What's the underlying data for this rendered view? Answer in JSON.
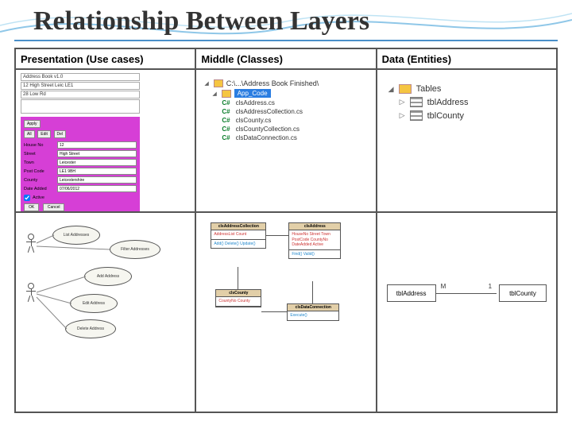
{
  "title": "Relationship Between Layers",
  "columns": {
    "c1": "Presentation (Use cases)",
    "c2": "Middle (Classes)",
    "c3": "Data (Entities)"
  },
  "form": {
    "list_header": "Address Book v1.0",
    "list_line2": "12 High Street Leic LE1",
    "list_line3": "28 Low Rd",
    "fields": {
      "houseNo": {
        "label": "House No",
        "value": "12"
      },
      "street": {
        "label": "Street",
        "value": "High Street"
      },
      "town": {
        "label": "Town",
        "value": "Leicester"
      },
      "postcode": {
        "label": "Post Code",
        "value": "LE1 9BH"
      },
      "county": {
        "label": "County",
        "value": "Leicestershire"
      },
      "dateAdded": {
        "label": "Date Added",
        "value": "07/06/2012"
      }
    },
    "buttons": {
      "apply": "Apply",
      "all": "All",
      "edit": "Edit",
      "delete": "Del"
    },
    "active": "Active",
    "ok": "OK",
    "cancel": "Cancel"
  },
  "solutionTree": {
    "root": "C:\\...\\Address Book Finished\\",
    "folder": "App_Code",
    "files": [
      "clsAddress.cs",
      "clsAddressCollection.cs",
      "clsCounty.cs",
      "clsCountyCollection.cs",
      "clsDataConnection.cs"
    ]
  },
  "dbTree": {
    "group": "Tables",
    "tables": [
      "tblAddress",
      "tblCounty"
    ]
  },
  "useCases": {
    "uc1": "List Addresses",
    "uc2": "Filter Addresses",
    "uc3": "Add Address",
    "uc4": "Edit Address",
    "uc5": "Delete Address"
  },
  "classes": {
    "a": {
      "name": "clsAddressCollection",
      "attrs": "AddressList\nCount",
      "ops": "Add()\nDelete()\nUpdate()"
    },
    "b": {
      "name": "clsAddress",
      "attrs": "HouseNo\nStreet\nTown\nPostCode\nCountyNo\nDateAdded\nActive",
      "ops": "Find()\nValid()"
    },
    "c": {
      "name": "clsCounty",
      "attrs": "CountyNo\nCounty",
      "ops": ""
    },
    "d": {
      "name": "clsDataConnection",
      "attrs": "",
      "ops": "Execute()"
    }
  },
  "er": {
    "left": "tblAddress",
    "right": "tblCounty",
    "leftCard": "M",
    "rightCard": "1"
  }
}
